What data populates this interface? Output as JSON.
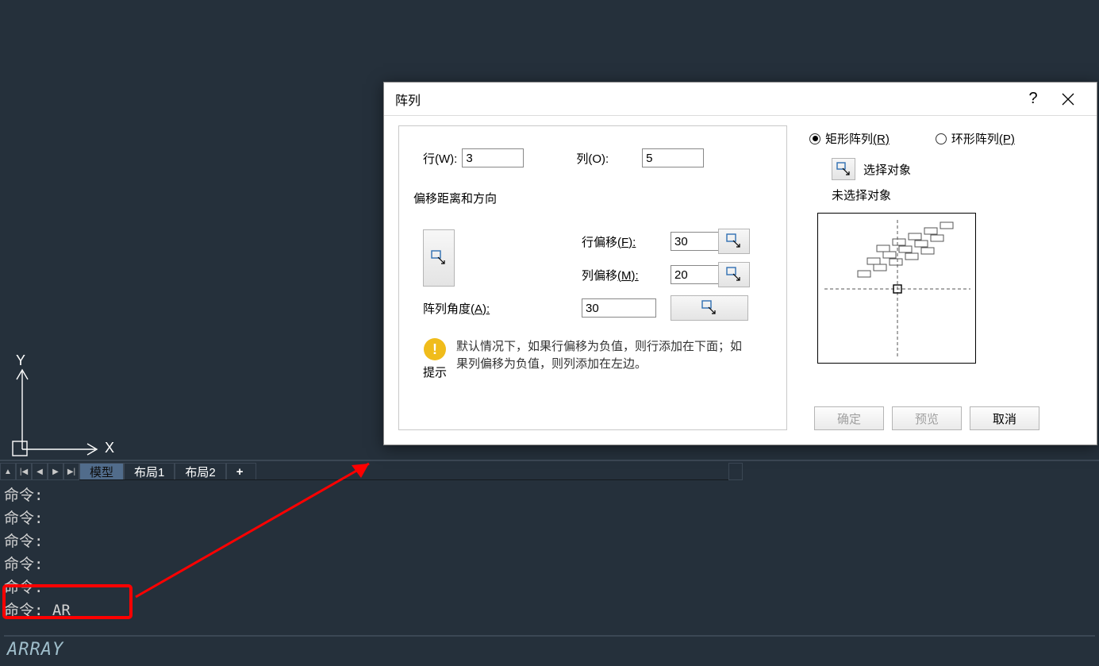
{
  "dialog": {
    "title": "阵列",
    "help_glyph": "?",
    "rect_label_a": "矩形阵列",
    "rect_label_b": "(R)",
    "polar_label_a": "环形阵列",
    "polar_label_b": "(P)",
    "select_label": "选择对象",
    "status_label": "未选择对象",
    "rows_label": "行(W):",
    "cols_label": "列(O):",
    "rows_value": "3",
    "cols_value": "5",
    "offset_title": "偏移距离和方向",
    "row_offset_label_a": "行偏移",
    "row_offset_label_b": "(F):",
    "col_offset_label_a": "列偏移",
    "col_offset_label_b": "(M):",
    "angle_label_a": "阵列角度",
    "angle_label_b": "(A):",
    "row_offset_value": "30",
    "col_offset_value": "20",
    "angle_value": "30",
    "tip_title": "提示",
    "tip_text": "默认情况下，如果行偏移为负值，则行添加在下面；如果列偏移为负值，则列添加在左边。",
    "ok_label": "确定",
    "preview_label": "预览",
    "cancel_label": "取消"
  },
  "tabs": {
    "model": "模型",
    "layout1": "布局1",
    "layout2": "布局2",
    "add": "+"
  },
  "nav_glyphs": {
    "up": "▲",
    "first": "|◀",
    "prev": "◀",
    "next": "▶",
    "last": "▶|"
  },
  "cmd_history": {
    "l1": "命令:",
    "l2": "命令:",
    "l3": "命令:",
    "l4": "命令:",
    "l5": "命令:",
    "l6": "命令: AR"
  },
  "cmd_line": "ARRAY",
  "axes": {
    "y_label": "Y",
    "x_label": "X"
  }
}
